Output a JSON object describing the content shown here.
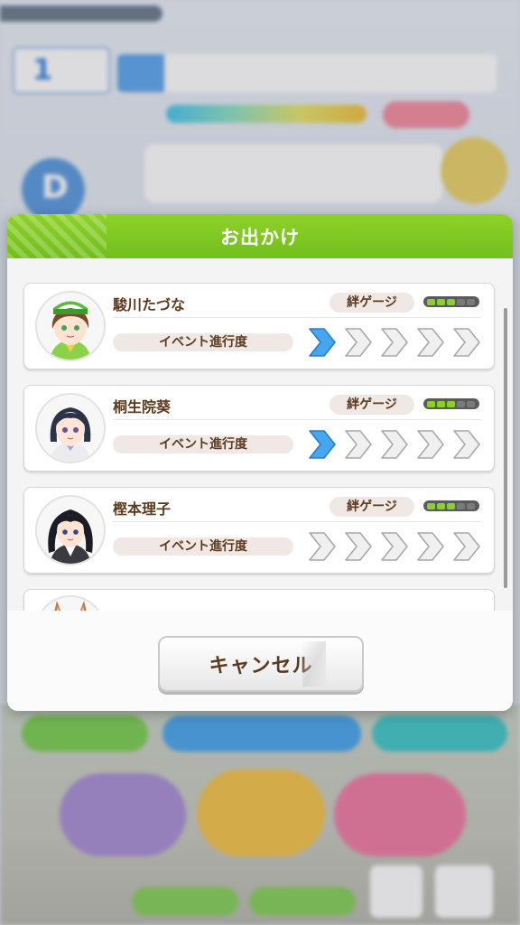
{
  "modal": {
    "title": "お出かけ",
    "cancel_label": "キャンセル"
  },
  "characters": [
    {
      "name": "駿川たづな",
      "bond_label": "絆ゲージ",
      "bond_level": 0.6,
      "event_label": "イベント進行度",
      "event_progress": 1,
      "event_total": 5
    },
    {
      "name": "桐生院葵",
      "bond_label": "絆ゲージ",
      "bond_level": 0.6,
      "event_label": "イベント進行度",
      "event_progress": 1,
      "event_total": 5
    },
    {
      "name": "樫本理子",
      "bond_label": "絆ゲージ",
      "bond_level": 0.6,
      "event_label": "イベント進行度",
      "event_progress": 0,
      "event_total": 5
    }
  ],
  "background": {
    "turn_number": "1",
    "grade": "D"
  },
  "colors": {
    "header_green": "#7cc621",
    "chevron_active": "#46a6ee",
    "chevron_inactive": "#f0f0f0",
    "text_brown": "#5b3a1e"
  }
}
